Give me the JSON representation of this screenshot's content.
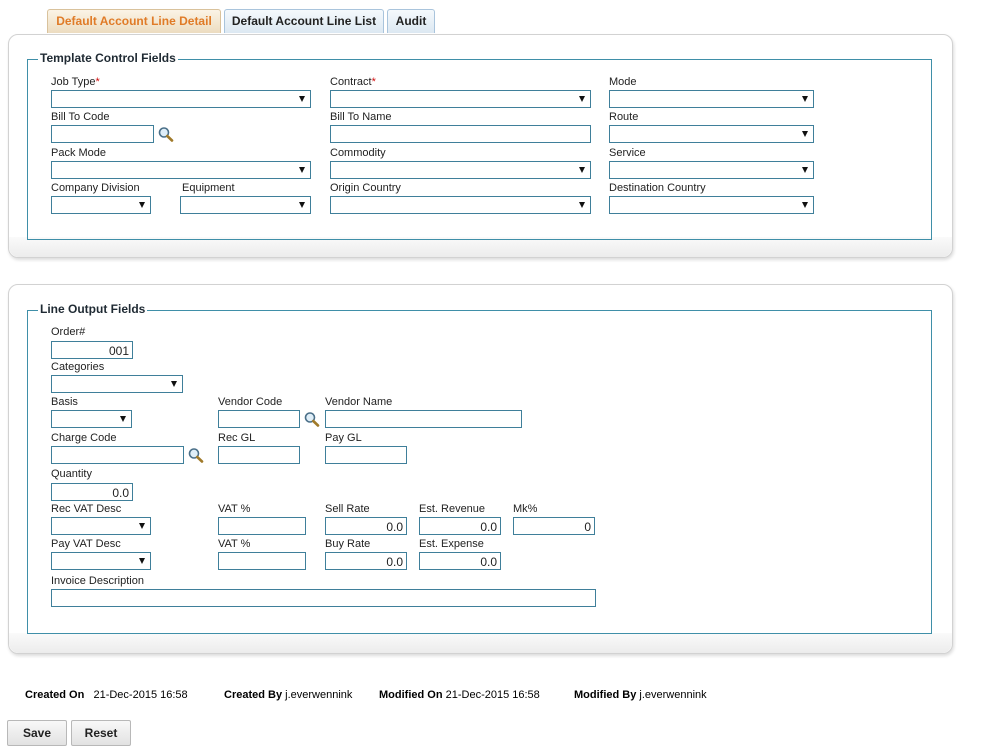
{
  "tabs": [
    {
      "label": "Default Account Line Detail",
      "active": true
    },
    {
      "label": "Default Account Line List",
      "active": false
    },
    {
      "label": "Audit",
      "active": false
    }
  ],
  "template_panel": {
    "legend": "Template Control Fields",
    "job_type_label": "Job Type",
    "contract_label": "Contract",
    "required_mark": "*",
    "mode_label": "Mode",
    "bill_to_code_label": "Bill To Code",
    "bill_to_name_label": "Bill To Name",
    "route_label": "Route",
    "pack_mode_label": "Pack Mode",
    "commodity_label": "Commodity",
    "service_label": "Service",
    "company_division_label": "Company Division",
    "equipment_label": "Equipment",
    "origin_country_label": "Origin Country",
    "destination_country_label": "Destination Country"
  },
  "output_panel": {
    "legend": "Line Output Fields",
    "order_label": "Order#",
    "order_value": "001",
    "categories_label": "Categories",
    "basis_label": "Basis",
    "vendor_code_label": "Vendor Code",
    "vendor_name_label": "Vendor Name",
    "charge_code_label": "Charge Code",
    "rec_gl_label": "Rec GL",
    "pay_gl_label": "Pay GL",
    "quantity_label": "Quantity",
    "quantity_value": "0.0",
    "rec_vat_desc_label": "Rec VAT Desc",
    "rec_vat_pct_label": "VAT %",
    "sell_rate_label": "Sell Rate",
    "sell_rate_value": "0.0",
    "est_revenue_label": "Est. Revenue",
    "est_revenue_value": "0.0",
    "mk_pct_label": "Mk%",
    "mk_pct_value": "0",
    "pay_vat_desc_label": "Pay VAT Desc",
    "pay_vat_pct_label": "VAT %",
    "buy_rate_label": "Buy Rate",
    "buy_rate_value": "0.0",
    "est_expense_label": "Est. Expense",
    "est_expense_value": "0.0",
    "invoice_description_label": "Invoice Description"
  },
  "audit": {
    "created_on_label": "Created On",
    "created_on_value": "21-Dec-2015 16:58",
    "created_by_label": "Created By",
    "created_by_value": "j.everwennink",
    "modified_on_label": "Modified On",
    "modified_on_value": "21-Dec-2015 16:58",
    "modified_by_label": "Modified By",
    "modified_by_value": "j.everwennink"
  },
  "buttons": {
    "save": "Save",
    "reset": "Reset"
  },
  "icons": {
    "lookup": "magnifier-icon",
    "dropdown": "chevron-down-icon"
  },
  "colors": {
    "accent_tab_text": "#e07b27",
    "field_border": "#3f7f9a",
    "required": "#d01010"
  }
}
